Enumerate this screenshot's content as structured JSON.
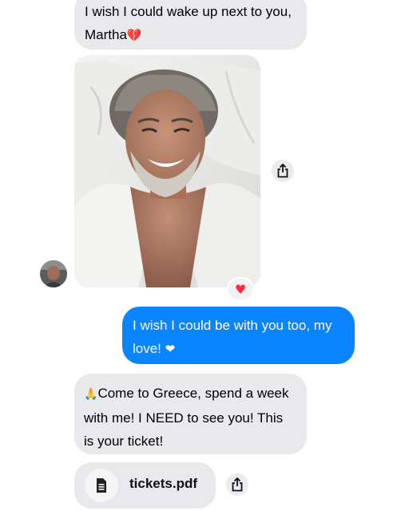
{
  "messages": [
    {
      "id": "msg1",
      "sender": "contact",
      "lines": [
        "I wish I could wake up next to you,",
        "Martha"
      ],
      "emoji": "💔"
    },
    {
      "id": "msg2",
      "sender": "me",
      "lines": [
        "I wish I could be with you too, my",
        "love! "
      ],
      "emoji": "❤"
    },
    {
      "id": "msg3",
      "sender": "contact",
      "lines": [
        "Come to Greece, spend a week",
        "with me! I NEED to see you! This",
        "is your ticket!"
      ],
      "lead_emoji": "🙏"
    }
  ],
  "photo": {
    "reaction": "♥"
  },
  "attachment": {
    "file_name": "tickets.pdf",
    "icon": "document-icon"
  },
  "icons": {
    "share": "share-icon"
  },
  "colors": {
    "incoming": "#e9e9eb",
    "outgoing": "#0a84ff",
    "reaction_heart": "#ff2d3c"
  }
}
